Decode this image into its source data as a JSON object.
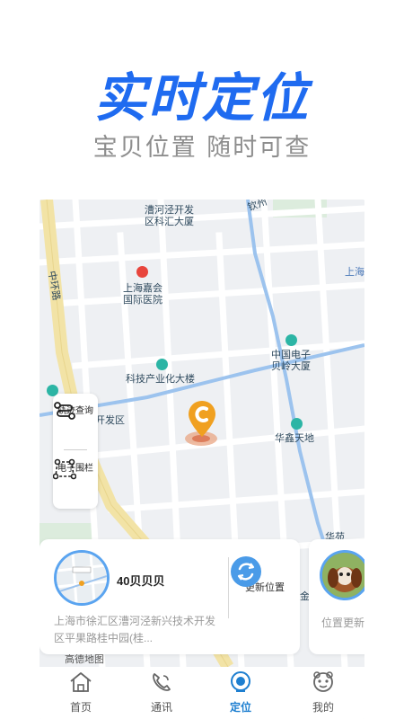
{
  "promo": {
    "title": "实时定位",
    "subtitle": "宝贝位置 随时可查"
  },
  "map": {
    "labels": {
      "top_building": "漕河泾开发\n区科汇大厦",
      "road_top": "钦州",
      "hospital": "上海嘉会\n国际医院",
      "ring_road": "中环路",
      "right_top": "上海",
      "electronics": "中国电子\n贝岭大厦",
      "tech_building": "科技产业化大楼",
      "dev_zone": "开发区",
      "huaxin": "华鑫天地",
      "partial_right": "华苑",
      "amap": "高德地图",
      "jin": "金"
    },
    "colors": {
      "river": "#9cc3ee",
      "ring_road": "#f3e3a8",
      "poi_teal": "#2cb5a5",
      "poi_red": "#e8453c",
      "marker": "#f0a020"
    }
  },
  "tools": {
    "track": {
      "label": "轨迹查询",
      "icon": "track-icon"
    },
    "fence": {
      "label": "电子围栏",
      "icon": "fence-icon"
    }
  },
  "location_card": {
    "pet_name": "40贝贝贝",
    "address": "上海市徐汇区漕河泾新兴技术开发区平果路桂中园(桂...",
    "refresh_label": "更新位置",
    "second_card_label": "位置更新"
  },
  "tabbar": {
    "items": [
      {
        "label": "首页",
        "icon": "home-icon"
      },
      {
        "label": "通讯",
        "icon": "phone-icon"
      },
      {
        "label": "定位",
        "icon": "locate-icon",
        "active": true
      },
      {
        "label": "我的",
        "icon": "profile-icon"
      }
    ]
  }
}
